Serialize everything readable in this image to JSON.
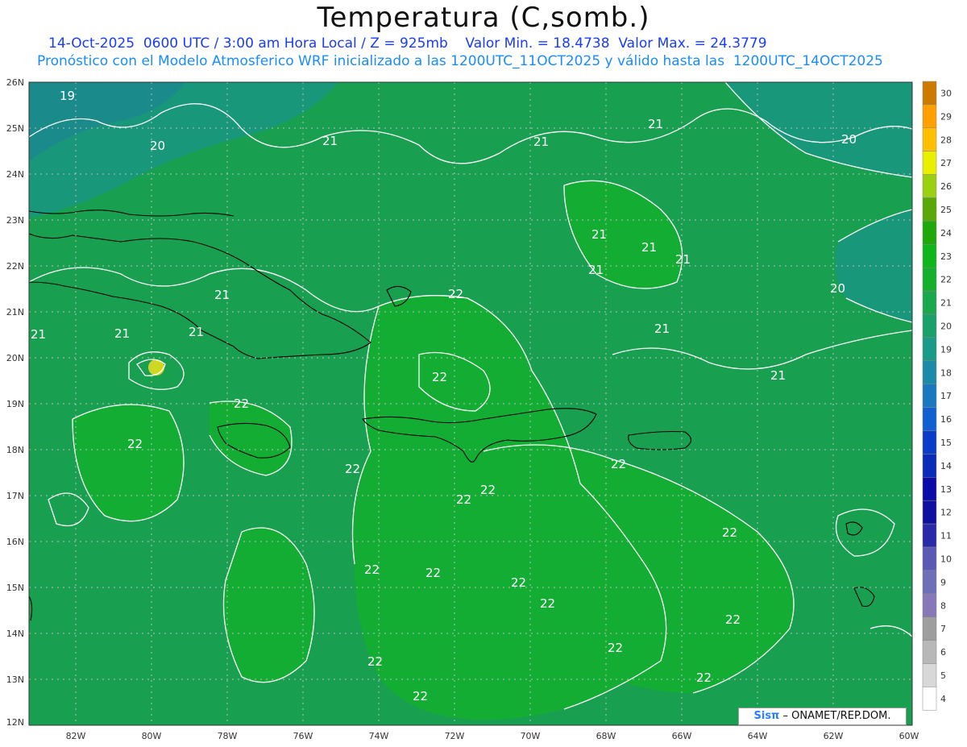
{
  "title": "Temperatura (C,somb.)",
  "subtitle_line1": "14-Oct-2025  0600 UTC / 3:00 am Hora Local / Z = 925mb    Valor Min. = 18.4738  Valor Max. = 24.3779",
  "subtitle_line2": "Pronóstico con el Modelo Atmosferico WRF inicializado a las 1200UTC_11OCT2025 y válido hasta las  1200UTC_14OCT2025",
  "credit": {
    "logo": "Sisπ",
    "org": " – ONAMET/REP.DOM."
  },
  "lat_labels": [
    "26N",
    "25N",
    "24N",
    "23N",
    "22N",
    "21N",
    "20N",
    "19N",
    "18N",
    "17N",
    "16N",
    "15N",
    "14N",
    "13N",
    "12N"
  ],
  "lon_labels": [
    "82W",
    "80W",
    "78W",
    "76W",
    "74W",
    "72W",
    "70W",
    "68W",
    "66W",
    "64W",
    "62W",
    "60W"
  ],
  "colorbar": {
    "levels": [
      "4",
      "5",
      "6",
      "7",
      "8",
      "9",
      "10",
      "11",
      "12",
      "13",
      "14",
      "15",
      "16",
      "17",
      "18",
      "19",
      "20",
      "21",
      "22",
      "23",
      "24",
      "25",
      "26",
      "27",
      "28",
      "29",
      "30"
    ],
    "colors": [
      "#ffffff",
      "#d8d8d8",
      "#b8b8b8",
      "#9e9e9e",
      "#8878b8",
      "#6f6fb8",
      "#5a5ab4",
      "#2a2aa8",
      "#1010a0",
      "#0a0aa8",
      "#0a2ab8",
      "#0a3cc8",
      "#1060d0",
      "#1878c0",
      "#1a8aa8",
      "#1a9a88",
      "#1aa06a",
      "#19a84c",
      "#14b02c",
      "#0fb51a",
      "#1ea80a",
      "#5aa808",
      "#9ad010",
      "#e8f000",
      "#ffc000",
      "#ffa000",
      "#cc7a00"
    ]
  },
  "contour_labels": [
    "19",
    "20",
    "21",
    "21",
    "21",
    "21",
    "21",
    "21",
    "21",
    "21",
    "21",
    "21",
    "21",
    "21",
    "21",
    "20",
    "20",
    "22",
    "22",
    "22",
    "22",
    "22",
    "22",
    "22",
    "22",
    "22",
    "22",
    "22",
    "22",
    "22",
    "22",
    "22",
    "22",
    "22",
    "22"
  ]
}
